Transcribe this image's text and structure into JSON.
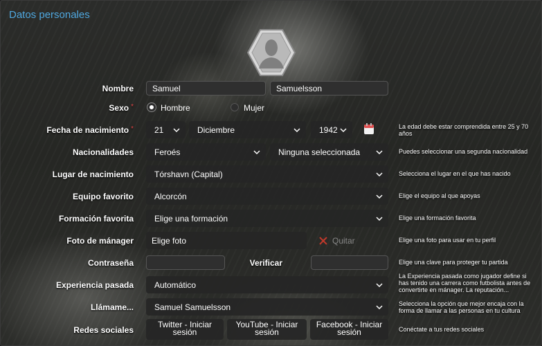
{
  "title": "Datos personales",
  "labels": {
    "nombre": "Nombre",
    "sexo": "Sexo",
    "fecha": "Fecha de nacimiento",
    "nacionalidades": "Nacionalidades",
    "lugar": "Lugar de nacimiento",
    "equipo": "Equipo favorito",
    "formacion": "Formación favorita",
    "foto": "Foto de mánager",
    "contrasena": "Contraseña",
    "verificar": "Verificar",
    "experiencia": "Experiencia pasada",
    "llamame": "Llámame...",
    "redes": "Redes sociales",
    "required": "*"
  },
  "fields": {
    "first_name": "Samuel",
    "last_name": "Samuelsson",
    "sex_options": [
      "Hombre",
      "Mujer"
    ],
    "sex_selected": "Hombre",
    "birth_day": "21",
    "birth_month": "Diciembre",
    "birth_year": "1942",
    "nationality_1": "Feroés",
    "nationality_2": "Ninguna seleccionada",
    "birthplace": "Tórshavn (Capital)",
    "favorite_team": "Alcorcón",
    "favorite_formation": "Elige una formación",
    "photo_button": "Elige foto",
    "photo_remove": "Quitar",
    "password": "",
    "password_verify": "",
    "experience": "Automático",
    "call_me": "Samuel Samuelsson"
  },
  "social": [
    {
      "label": "Twitter - Iniciar sesión"
    },
    {
      "label": "YouTube - Iniciar sesión"
    },
    {
      "label": "Facebook - Iniciar sesión"
    }
  ],
  "help": {
    "fecha": "La edad debe estar comprendida entre 25 y 70 años",
    "nacionalidades": "Puedes seleccionar una segunda nacionalidad",
    "lugar": "Selecciona el lugar en el que has nacido",
    "equipo": "Elige el equipo al que apoyas",
    "formacion": "Elige una formación favorita",
    "foto": "Elige una foto para usar en tu perfil",
    "contrasena": "Elige una clave para proteger tu partida",
    "experiencia": "La Experiencia pasada como jugador define si has tenido una carrera como futbolista antes de convertirte en mánager. La reputación...",
    "llamame": "Selecciona la opción que mejor encaja con la forma de llamar a las personas en tu cultura",
    "redes": "Conéctate a tus redes sociales"
  },
  "colors": {
    "accent": "#4fa8e0",
    "required": "#e04848",
    "calendar": "#e05050",
    "remove_x": "#c0392b"
  },
  "icons": {
    "avatar": "avatar-hexagon-icon",
    "calendar": "calendar-icon",
    "dropdown": "chevron-down-icon",
    "remove": "close-icon"
  }
}
